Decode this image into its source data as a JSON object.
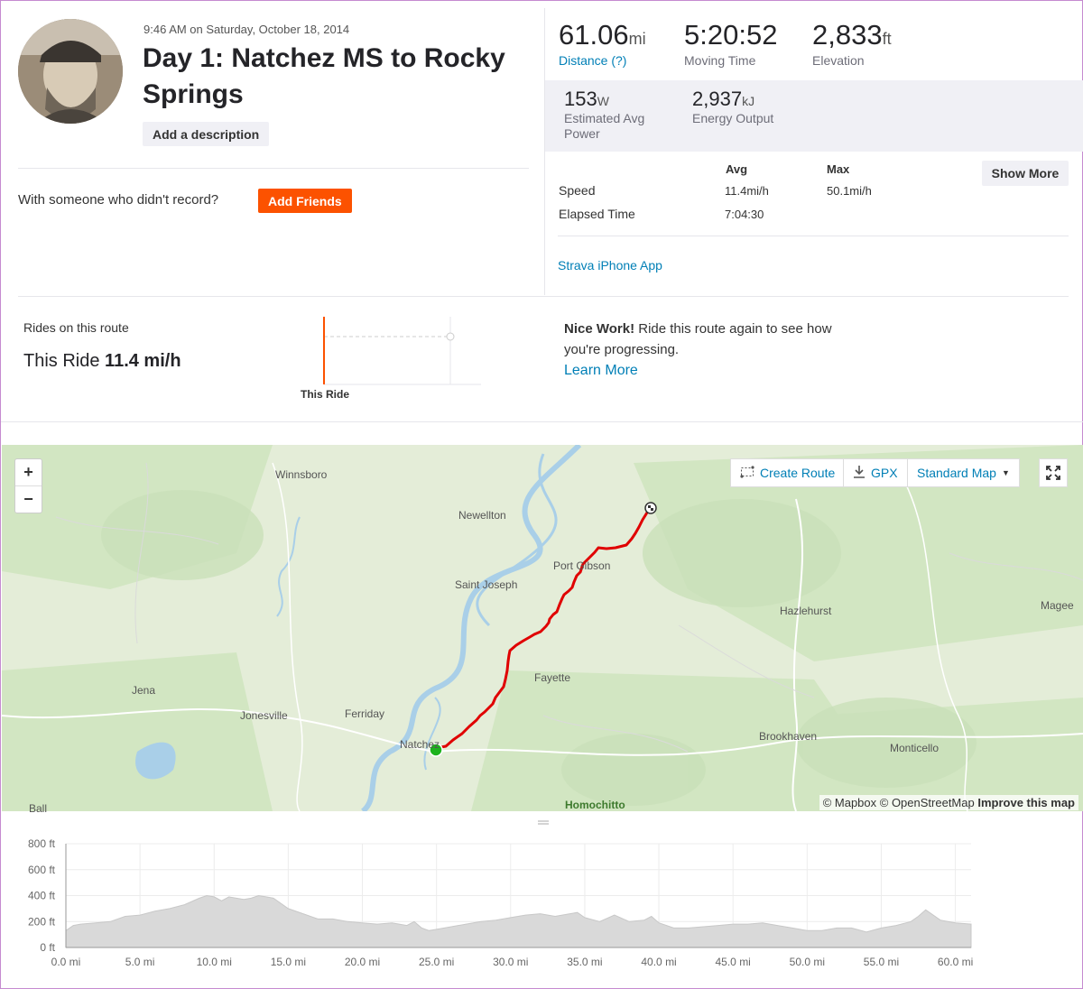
{
  "activity": {
    "timestamp": "9:46 AM on Saturday, October 18, 2014",
    "title": "Day 1: Natchez MS to Rocky Springs",
    "add_description": "Add a description",
    "with_someone": "With someone who didn't record?",
    "add_friends": "Add Friends"
  },
  "stats": {
    "distance": {
      "value": "61.06",
      "unit": "mi",
      "label": "Distance (?)"
    },
    "moving_time": {
      "value": "5:20:52",
      "label": "Moving Time"
    },
    "elevation": {
      "value": "2,833",
      "unit": "ft",
      "label": "Elevation"
    },
    "power": {
      "value": "153",
      "unit": "W",
      "label": "Estimated Avg Power"
    },
    "energy": {
      "value": "2,937",
      "unit": "kJ",
      "label": "Energy Output"
    }
  },
  "table": {
    "avg_header": "Avg",
    "max_header": "Max",
    "show_more": "Show More",
    "rows": [
      {
        "label": "Speed",
        "avg": "11.4mi/h",
        "max": "50.1mi/h"
      },
      {
        "label": "Elapsed Time",
        "avg": "7:04:30",
        "max": ""
      }
    ],
    "device": "Strava iPhone App"
  },
  "rides": {
    "label": "Rides on this route",
    "this_ride_prefix": "This Ride",
    "this_ride_speed": "11.4 mi/h",
    "chart_label": "This Ride",
    "nice_bold": "Nice Work!",
    "nice_text": " Ride this route again to see how you're progressing.",
    "learn_more": "Learn More"
  },
  "map": {
    "zoom_in": "+",
    "zoom_out": "−",
    "create_route": "Create Route",
    "gpx": "GPX",
    "map_style": "Standard Map",
    "attribution_1": "© Mapbox © OpenStreetMap",
    "attribution_2": "Improve this map",
    "places": {
      "winnsboro": "Winnsboro",
      "newellton": "Newellton",
      "port_gibson": "Port Gibson",
      "saint_joseph": "Saint Joseph",
      "hazlehurst": "Hazlehurst",
      "magee": "Magee",
      "jena": "Jena",
      "fayette": "Fayette",
      "jonesville": "Jonesville",
      "ferriday": "Ferriday",
      "natchez": "Natchez",
      "brookhaven": "Brookhaven",
      "monticello": "Monticello",
      "homochitto": "Homochitto",
      "ball": "Ball"
    },
    "route_color": "#e00000",
    "start_color": "#1db31d"
  },
  "chart_data": {
    "type": "area",
    "xlabel": "",
    "ylabel": "",
    "x_ticks": [
      "0.0 mi",
      "5.0 mi",
      "10.0 mi",
      "15.0 mi",
      "20.0 mi",
      "25.0 mi",
      "30.0 mi",
      "35.0 mi",
      "40.0 mi",
      "45.0 mi",
      "50.0 mi",
      "55.0 mi",
      "60.0 mi"
    ],
    "y_ticks": [
      "0 ft",
      "200 ft",
      "400 ft",
      "600 ft",
      "800 ft"
    ],
    "xlim": [
      0,
      61.06
    ],
    "ylim": [
      0,
      800
    ],
    "grid": true,
    "x": [
      0,
      0.5,
      1,
      2,
      3,
      4,
      5,
      6,
      7,
      8,
      9,
      9.5,
      10,
      10.5,
      11,
      12,
      12.5,
      13,
      13.5,
      14,
      15,
      16,
      17,
      18,
      19,
      20,
      21,
      22,
      23,
      23.5,
      24,
      24.5,
      25,
      26,
      27,
      28,
      29,
      30,
      31,
      32,
      33,
      34,
      34.5,
      35,
      36,
      37,
      38,
      39,
      39.5,
      40,
      41,
      42,
      43,
      44,
      45,
      46,
      47,
      48,
      49,
      50,
      51,
      52,
      53,
      54,
      55,
      56,
      57,
      57.5,
      58,
      59,
      60,
      61.06
    ],
    "y": [
      130,
      170,
      180,
      190,
      200,
      240,
      250,
      280,
      300,
      330,
      380,
      400,
      390,
      360,
      390,
      370,
      380,
      400,
      390,
      380,
      300,
      260,
      220,
      220,
      200,
      190,
      180,
      190,
      170,
      200,
      150,
      130,
      140,
      160,
      180,
      200,
      210,
      230,
      250,
      260,
      240,
      260,
      270,
      230,
      200,
      250,
      200,
      210,
      240,
      190,
      150,
      150,
      160,
      170,
      180,
      180,
      190,
      170,
      150,
      130,
      130,
      150,
      150,
      120,
      150,
      170,
      200,
      240,
      290,
      210,
      190,
      180
    ],
    "series": [
      {
        "name": "",
        "color": "#d9d9d9"
      }
    ]
  }
}
